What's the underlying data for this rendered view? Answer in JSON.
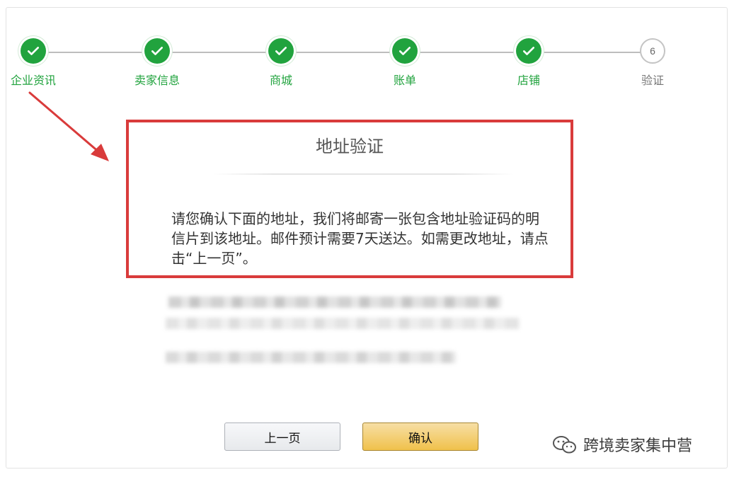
{
  "stepper": {
    "steps": [
      {
        "label": "企业资讯",
        "state": "done"
      },
      {
        "label": "卖家信息",
        "state": "done"
      },
      {
        "label": "商城",
        "state": "done"
      },
      {
        "label": "账单",
        "state": "done"
      },
      {
        "label": "店铺",
        "state": "done"
      },
      {
        "label": "验证",
        "state": "pending",
        "number": "6"
      }
    ]
  },
  "notice": {
    "title": "地址验证",
    "body": "请您确认下面的地址，我们将邮寄一张包含地址验证码的明信片到该地址。邮件预计需要7天送达。如需更改地址，请点击“上一页”。"
  },
  "buttons": {
    "prev_label": "上一页",
    "confirm_label": "确认"
  },
  "watermark": {
    "text": "跨境卖家集中营"
  },
  "colors": {
    "step_done": "#21a33e",
    "highlight_border": "#d93b3b",
    "confirm_button": "#f0c14b"
  },
  "icons": {
    "step_done": "check-icon",
    "annotation": "arrow-icon",
    "watermark": "wechat-icon"
  }
}
